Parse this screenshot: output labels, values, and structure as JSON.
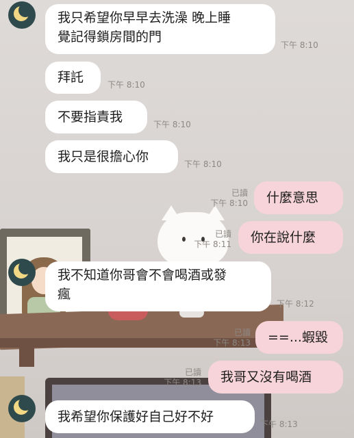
{
  "messages": [
    {
      "dir": "in",
      "text": "我只希望你早早去洗澡 晚上睡\n覺記得鎖房間的門",
      "time": "下午 8:10",
      "avatar": true
    },
    {
      "dir": "in",
      "text": "拜託",
      "time": "下午 8:10"
    },
    {
      "dir": "in",
      "text": "不要指責我",
      "time": "下午 8:10"
    },
    {
      "dir": "in",
      "text": "我只是很擔心你",
      "time": "下午 8:10"
    },
    {
      "dir": "out",
      "text": "什麼意思",
      "read": "已讀",
      "time": "下午 8:10"
    },
    {
      "dir": "out",
      "text": "你在說什麼",
      "read": "已讀",
      "time": "下午 8:11"
    },
    {
      "dir": "in",
      "text": "我不知道你哥會不會喝酒或發\n瘋",
      "time": "下午 8:12",
      "avatar": true
    },
    {
      "dir": "out",
      "text": "==...蝦毀",
      "read": "已讀",
      "time": "下午 8:13"
    },
    {
      "dir": "out",
      "text": "我哥又沒有喝酒",
      "read": "已讀",
      "time": "下午 8:13"
    },
    {
      "dir": "in",
      "text": "我希望你保護好自己好不好",
      "time": "下午 8:13",
      "avatar": true
    }
  ],
  "avatar_icon": "crescent-moon-icon",
  "colors": {
    "incoming": "#ffffff",
    "outgoing": "#f7d4d9",
    "avatar_bg": "#2f4a4c",
    "moon": "#f2d785"
  }
}
